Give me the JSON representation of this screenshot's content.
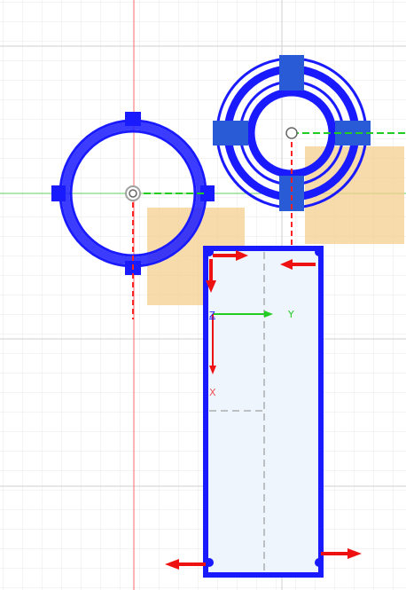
{
  "viewport": {
    "name": "cad-sketch-canvas",
    "background": "#ffffff",
    "grid_minor_color": "#e6e6e6",
    "grid_major_color": "#cfcfcf"
  },
  "colors": {
    "sketch_blue": "#1a1aff",
    "profile_fill": "#d6e6f7",
    "dimension_orange": "#f4c77f",
    "axis_red": "#ff4040",
    "axis_green": "#22cc22",
    "arrow_red": "#ee1111",
    "origin_gray": "#999999"
  },
  "triad": {
    "z_label": "Z",
    "y_label": "Y",
    "x_label": "X"
  }
}
